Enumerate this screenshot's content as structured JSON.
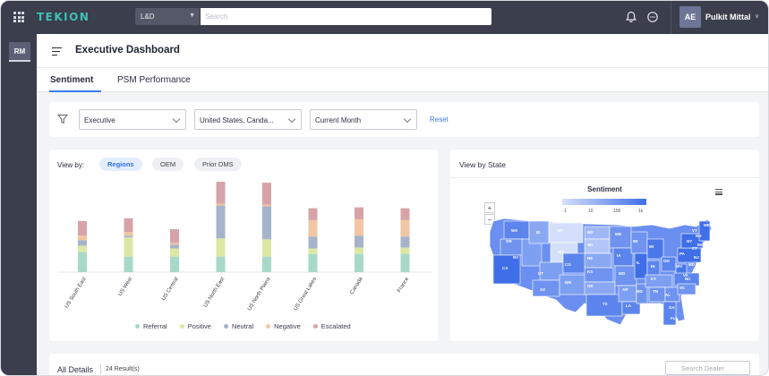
{
  "topbar": {
    "brand": "TEKION",
    "scope_selector": "L&D",
    "search_placeholder": "Search",
    "user_initials": "AE",
    "user_name": "Pulkit Mittal"
  },
  "rail": {
    "active_tile": "RM"
  },
  "header": {
    "title": "Executive Dashboard"
  },
  "tabs": [
    {
      "label": "Sentiment",
      "active": true
    },
    {
      "label": "PSM Performance",
      "active": false
    }
  ],
  "filters": {
    "role": "Executive",
    "country": "United States, Canda...",
    "period": "Current Month",
    "reset_label": "Reset"
  },
  "sentiment_card": {
    "view_by_label": "View by:",
    "options": [
      {
        "label": "Regions",
        "active": true
      },
      {
        "label": "OEM",
        "active": false
      },
      {
        "label": "Prior DMS",
        "active": false
      }
    ]
  },
  "chart_data": {
    "type": "bar",
    "stacked": true,
    "categories": [
      "US South East",
      "US West",
      "US Central",
      "US North East",
      "US North Plains",
      "US Great Lakes",
      "Canada",
      "France"
    ],
    "series": [
      {
        "name": "Referral",
        "color": "#a8d9c8",
        "values": [
          22,
          17,
          17,
          17,
          17,
          20,
          20,
          20
        ]
      },
      {
        "name": "Positive",
        "color": "#dde7a4",
        "values": [
          7,
          21,
          9,
          20,
          19,
          6,
          7,
          7
        ]
      },
      {
        "name": "Neutral",
        "color": "#a5b4ca",
        "values": [
          6,
          2,
          4,
          36,
          36,
          13,
          13,
          12
        ]
      },
      {
        "name": "Negative",
        "color": "#f2c6a3",
        "values": [
          5,
          4,
          2,
          2,
          2,
          18,
          18,
          18
        ]
      },
      {
        "name": "Escalated",
        "color": "#d7a3a8",
        "values": [
          16,
          15,
          15,
          24,
          24,
          13,
          13,
          13
        ]
      }
    ],
    "legend_position": "bottom",
    "grid": false
  },
  "map_card": {
    "title": "View by State",
    "map_title": "Sentiment",
    "scale_ticks": [
      "1",
      "10",
      "100",
      "1k"
    ],
    "zoom_in": "+",
    "zoom_out": "−",
    "state_labels": [
      "WA",
      "OR",
      "CA",
      "NV",
      "ID",
      "MT",
      "WY",
      "UT",
      "AZ",
      "CO",
      "NM",
      "ND",
      "SD",
      "NE",
      "KS",
      "OK",
      "TX",
      "MN",
      "IA",
      "MO",
      "AR",
      "LA",
      "WI",
      "IL",
      "MS",
      "MI",
      "IN",
      "KY",
      "TN",
      "AL",
      "OH",
      "WV",
      "GA",
      "FL",
      "SC",
      "NC",
      "VA",
      "PA",
      "NY",
      "ME",
      "VT",
      "NH",
      "MA",
      "CT",
      "NJ",
      "MD",
      "DE",
      "RI"
    ]
  },
  "details": {
    "title": "All Details",
    "count": "24 Result(s)",
    "search_placeholder": "Search Dealer"
  },
  "colors": {
    "topbar": "#3a3e4d",
    "brand": "#41c0b4",
    "accent": "#3d7cf0",
    "map_light": "#d4e0fb",
    "map_dark": "#3f6ee8"
  }
}
